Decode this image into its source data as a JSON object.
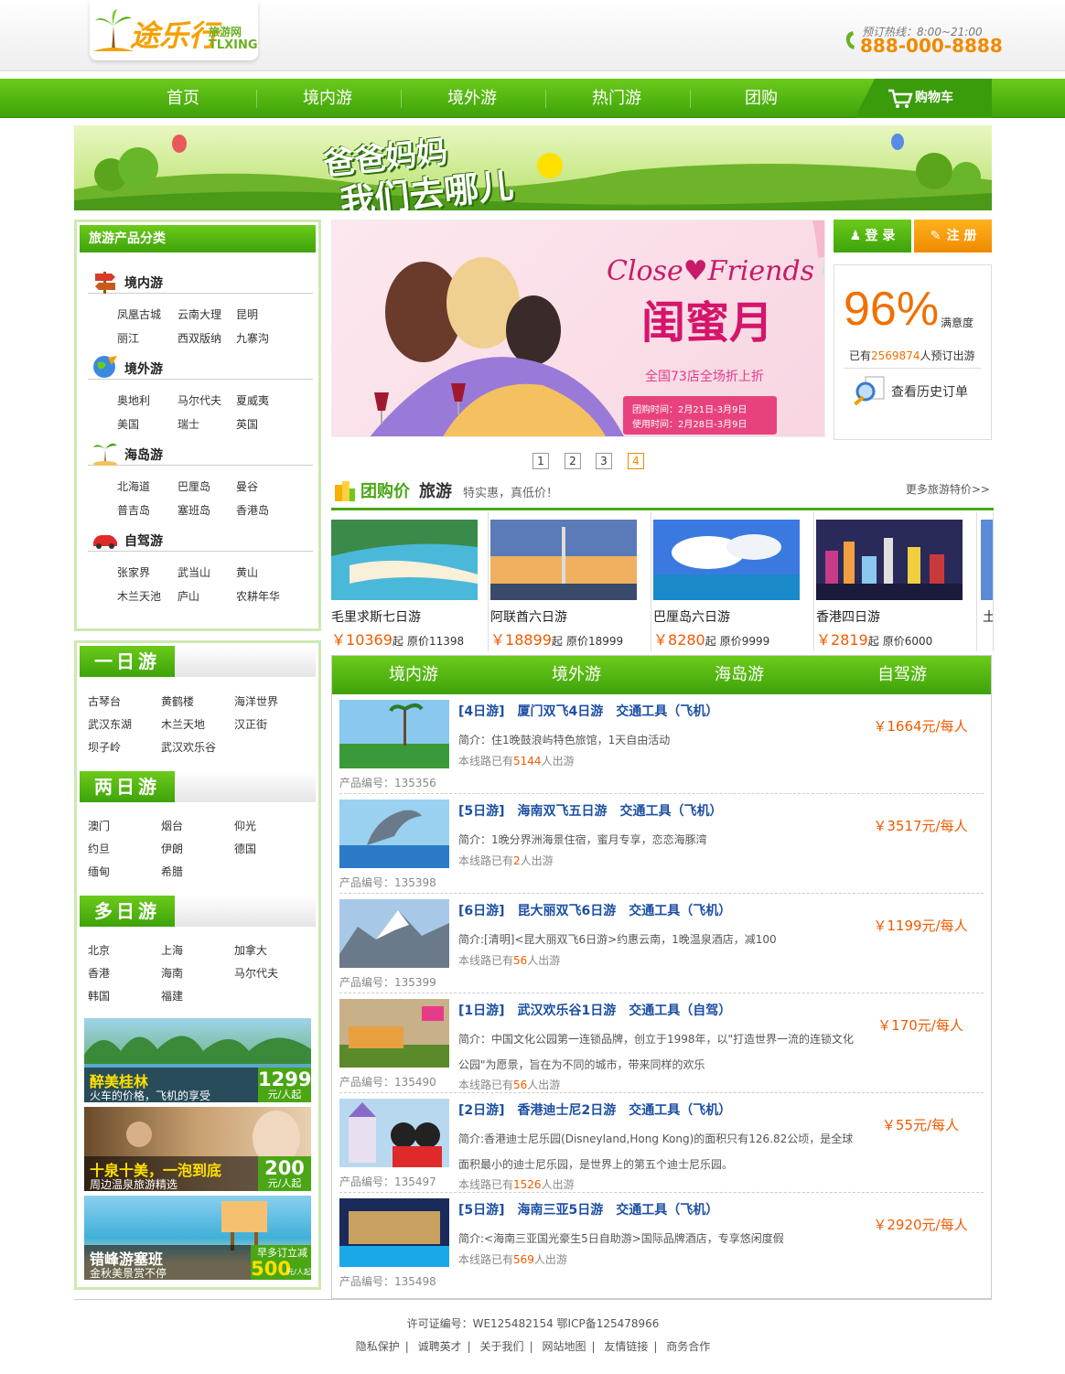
{
  "brand": {
    "name_cn": "途乐行",
    "sub": "旅游网",
    "name_en": "TLXING"
  },
  "hotline": {
    "label": "预订热线：8:00~21:00",
    "number": "888-000-8888"
  },
  "nav": {
    "items": [
      "首页",
      "境内游",
      "境外游",
      "热门游",
      "团购"
    ],
    "cart": "购物车"
  },
  "banner": {
    "line1": "爸爸妈妈",
    "line2": "我们去哪儿"
  },
  "categories": {
    "title": "旅游产品分类",
    "groups": [
      {
        "title": "境内游",
        "links": [
          "凤凰古城",
          "云南大理",
          "昆明",
          "丽江",
          "西双版纳",
          "九寨沟"
        ]
      },
      {
        "title": "境外游",
        "links": [
          "奥地利",
          "马尔代夫",
          "夏威夷",
          "美国",
          "瑞士",
          "英国"
        ]
      },
      {
        "title": "海岛游",
        "links": [
          "北海道",
          "巴厘岛",
          "曼谷",
          "普吉岛",
          "塞班岛",
          "香港岛"
        ]
      },
      {
        "title": "自驾游",
        "links": [
          "张家界",
          "武当山",
          "黄山",
          "木兰天池",
          "庐山",
          "农耕年华"
        ]
      }
    ]
  },
  "days": [
    {
      "title": "一日游",
      "links": [
        "古琴台",
        "黄鹤楼",
        "海洋世界",
        "武汉东湖",
        "木兰天地",
        "汉正街",
        "坝子岭",
        "武汉欢乐谷"
      ]
    },
    {
      "title": "两日游",
      "links": [
        "澳门",
        "烟台",
        "仰光",
        "约旦",
        "伊朗",
        "德国",
        "缅甸",
        "希腊"
      ]
    },
    {
      "title": "多日游",
      "links": [
        "北京",
        "上海",
        "加拿大",
        "香港",
        "海南",
        "马尔代夫",
        "韩国",
        "福建"
      ]
    }
  ],
  "promos": [
    {
      "title": "醉美桂林",
      "desc": "火车的价格，飞机的享受",
      "price": "1299",
      "unit": "元/人起"
    },
    {
      "title": "十泉十美，一泡到底",
      "desc": "周边温泉旅游精选",
      "price": "200",
      "unit": "元/人起"
    },
    {
      "title": "错峰游塞班",
      "desc": "金秋美景赏不停",
      "note": "早多订立减",
      "price": "500",
      "unit": "元/人起"
    }
  ],
  "slider": {
    "en": "Close♥Friends",
    "title": "闺蜜月",
    "sub": "全国73店全场折上折",
    "time1": "团购时间：2月21日-3月9日",
    "time2": "使用时间：2月28日-3月9日",
    "pages": [
      "1",
      "2",
      "3",
      "4"
    ],
    "active": "4"
  },
  "auth": {
    "login": "登 录",
    "register": "注 册"
  },
  "satisfaction": {
    "percent": "96%",
    "label": "满意度",
    "count_pre": "已有",
    "count": "2569874",
    "count_post": "人预订出游",
    "history": "查看历史订单"
  },
  "group": {
    "t1": "团购价",
    "t2": "旅游",
    "t3": "特实惠，真低价！",
    "more": "更多旅游特价>>",
    "items": [
      {
        "name": "毛里求斯七日游",
        "price": "10369",
        "orig": "原价11398"
      },
      {
        "name": "阿联酋六日游",
        "price": "18899",
        "orig": "原价18999"
      },
      {
        "name": "巴厘岛六日游",
        "price": "8280",
        "orig": "原价9999"
      },
      {
        "name": "香港四日游",
        "price": "2819",
        "orig": "原价6000"
      },
      {
        "name": "土",
        "price": "",
        "orig": ""
      }
    ],
    "currency": "￥",
    "qi": "起"
  },
  "tabs": [
    "境内游",
    "境外游",
    "海岛游",
    "自驾游"
  ],
  "tours": [
    {
      "title": "[4日游]　厦门双飞4日游　交通工具（飞机）",
      "desc": "简介：住1晚鼓浪屿特色旅馆，1天自由活动",
      "count": "5144",
      "price": "￥1664元/每人",
      "code": "产品编号：135356"
    },
    {
      "title": "[5日游]　海南双飞五日游　交通工具（飞机）",
      "desc": "简介：1晚分界洲海景住宿，蜜月专享，恋恋海豚湾",
      "count": "2",
      "price": "￥3517元/每人",
      "code": "产品编号：135398"
    },
    {
      "title": "[6日游]　昆大丽双飞6日游　交通工具（飞机）",
      "desc": "简介:[清明]<昆大丽双飞6日游>约惠云南，1晚温泉酒店，减100",
      "count": "56",
      "price": "￥1199元/每人",
      "code": "产品编号：135399"
    },
    {
      "title": "[1日游]　武汉欢乐谷1日游　交通工具（自驾）",
      "desc": "简介：中国文化公园第一连锁品牌，创立于1998年，以\"打造世界一流的连锁文化公园\"为愿景，旨在为不同的城市，带来同样的欢乐",
      "count": "56",
      "price": "￥170元/每人",
      "code": "产品编号：135490"
    },
    {
      "title": "[2日游]　香港迪士尼2日游　交通工具（飞机）",
      "desc": "简介:香港迪士尼乐园(Disneyland,Hong Kong)的面积只有126.82公顷，是全球面积最小的迪士尼乐园，是世界上的第五个迪士尼乐园。",
      "count": "1526",
      "price": "￥55元/每人",
      "code": "产品编号：135497"
    },
    {
      "title": "[5日游]　海南三亚5日游　交通工具（飞机）",
      "desc": "简介:<海南三亚国光豪生5日自助游>国际品牌酒店，专享悠闲度假",
      "count": "569",
      "price": "￥2920元/每人",
      "code": "产品编号：135498"
    }
  ],
  "tour_count_pre": "本线路已有",
  "tour_count_post": "人出游",
  "footer": {
    "license": "许可证编号：WE125482154 鄂ICP备125478966",
    "links": [
      "隐私保护",
      "诚聘英才",
      "关于我们",
      "网站地图",
      "友情链接",
      "商务合作"
    ],
    "sep": "|"
  }
}
